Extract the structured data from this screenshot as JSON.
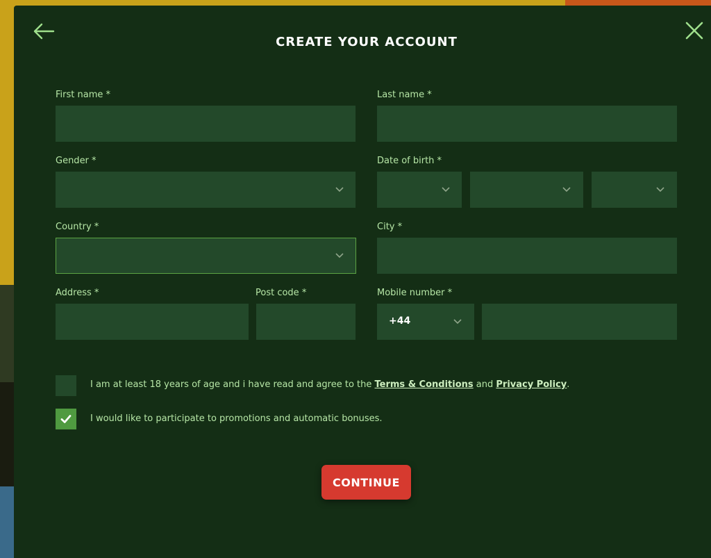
{
  "modal": {
    "title": "CREATE YOUR ACCOUNT",
    "back_icon": "arrow-left-icon",
    "close_icon": "close-icon"
  },
  "form": {
    "first_name": {
      "label": "First name *",
      "value": ""
    },
    "last_name": {
      "label": "Last name *",
      "value": ""
    },
    "gender": {
      "label": "Gender *",
      "value": ""
    },
    "date_of_birth": {
      "label": "Date of birth *",
      "day": "",
      "month": "",
      "year": ""
    },
    "country": {
      "label": "Country *",
      "value": ""
    },
    "city": {
      "label": "City *",
      "value": ""
    },
    "address": {
      "label": "Address *",
      "value": ""
    },
    "post_code": {
      "label": "Post code *",
      "value": ""
    },
    "mobile": {
      "label": "Mobile number *",
      "country_code": "+44",
      "value": ""
    }
  },
  "consents": {
    "age_terms": {
      "checked": false,
      "text_before": "I am at least 18 years of age and i have read and agree to the ",
      "terms_link": "Terms & Conditions",
      "text_middle": " and ",
      "privacy_link": "Privacy Policy",
      "text_after": "."
    },
    "promotions": {
      "checked": true,
      "text": "I would like to participate to promotions and automatic bonuses."
    }
  },
  "actions": {
    "continue_label": "CONTINUE"
  },
  "colors": {
    "modal_bg": "#142e15",
    "field_bg": "#23492a",
    "label": "#b6e6a6",
    "accent_green": "#4f9a40",
    "button_red": "#d63a2f"
  }
}
